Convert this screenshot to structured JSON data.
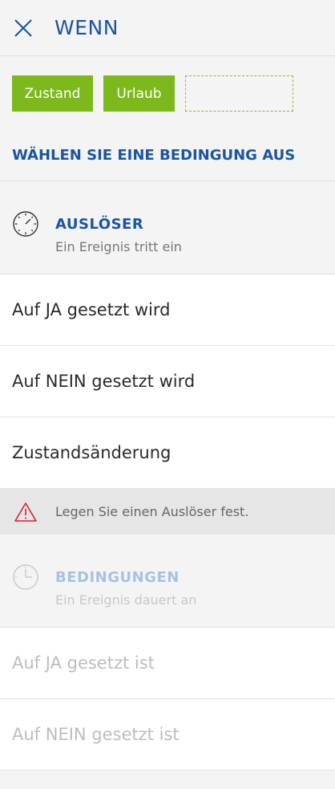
{
  "header": {
    "title": "WENN",
    "close_icon": "close-icon"
  },
  "chips": [
    {
      "label": "Zustand"
    },
    {
      "label": "Urlaub"
    },
    {
      "label": ""
    }
  ],
  "select_heading": "WÄHLEN SIE EINE BEDINGUNG AUS",
  "triggers": {
    "icon": "stopwatch-icon",
    "title": "AUSLÖSER",
    "subtitle": "Ein Ereignis tritt ein",
    "options": [
      {
        "label": "Auf JA gesetzt wird"
      },
      {
        "label": "Auf NEIN gesetzt wird"
      },
      {
        "label": "Zustandsänderung"
      }
    ]
  },
  "warning": {
    "icon": "warning-triangle-icon",
    "text": "Legen Sie einen Auslöser fest."
  },
  "conditions": {
    "icon": "clock-icon",
    "title": "BEDINGUNGEN",
    "subtitle": "Ein Ereignis dauert an",
    "options": [
      {
        "label": "Auf JA gesetzt ist"
      },
      {
        "label": "Auf NEIN gesetzt ist"
      }
    ]
  },
  "colors": {
    "brand_blue": "#1a55a3",
    "chip_green": "#7db81d",
    "warning_red": "#d8222a"
  }
}
